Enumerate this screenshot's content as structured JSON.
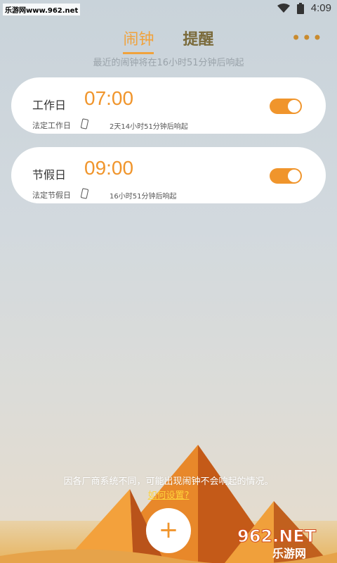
{
  "status_bar": {
    "watermark": "乐游网www.962.net",
    "time": "4:09",
    "icons": [
      "wifi-icon",
      "battery-icon"
    ]
  },
  "header": {
    "tabs": [
      {
        "label": "闹钟",
        "active": true
      },
      {
        "label": "提醒",
        "active": false
      }
    ],
    "more_icon": "more-icon",
    "subtitle": "最近的闹钟将在16小时51分钟后响起"
  },
  "alarms": [
    {
      "day": "工作日",
      "time": "07:00",
      "rule": "法定工作日",
      "countdown": "2天14小时51分钟后响起",
      "enabled": true
    },
    {
      "day": "节假日",
      "time": "09:00",
      "rule": "法定节假日",
      "countdown": "16小时51分钟后响起",
      "enabled": true
    }
  ],
  "footer": {
    "notice": "因各厂商系统不同，可能出现闹钟不会响起的情况。",
    "howto_link": "如何设置?",
    "add_label": "+",
    "watermark": "962.NET 乐游网"
  },
  "colors": {
    "accent": "#f0952c",
    "tab_active": "#f0a23c",
    "tab_inactive": "#7a6a3a",
    "link": "#ffd23a"
  }
}
